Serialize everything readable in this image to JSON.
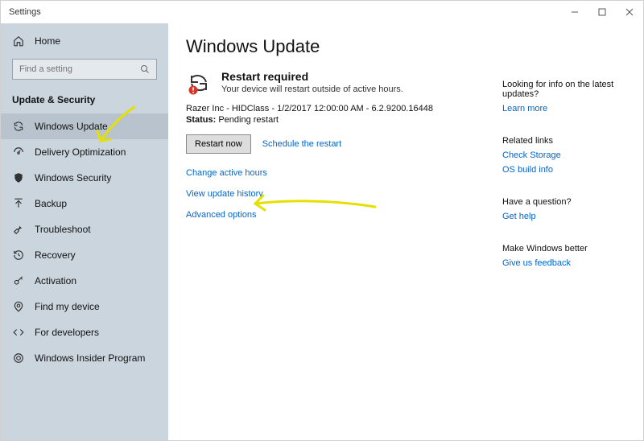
{
  "window": {
    "title": "Settings"
  },
  "sidebar": {
    "home": "Home",
    "search_placeholder": "Find a setting",
    "category": "Update & Security",
    "items": [
      {
        "label": "Windows Update"
      },
      {
        "label": "Delivery Optimization"
      },
      {
        "label": "Windows Security"
      },
      {
        "label": "Backup"
      },
      {
        "label": "Troubleshoot"
      },
      {
        "label": "Recovery"
      },
      {
        "label": "Activation"
      },
      {
        "label": "Find my device"
      },
      {
        "label": "For developers"
      },
      {
        "label": "Windows Insider Program"
      }
    ]
  },
  "main": {
    "heading": "Windows Update",
    "status_title": "Restart required",
    "status_sub": "Your device will restart outside of active hours.",
    "update_line": "Razer Inc - HIDClass - 1/2/2017 12:00:00 AM - 6.2.9200.16448",
    "status_label": "Status:",
    "status_value": "Pending restart",
    "restart_btn": "Restart now",
    "schedule_link": "Schedule the restart",
    "links": {
      "change_hours": "Change active hours",
      "view_history": "View update history",
      "advanced": "Advanced options"
    }
  },
  "right": {
    "info_title": "Looking for info on the latest updates?",
    "info_link": "Learn more",
    "related_title": "Related links",
    "related_links": {
      "storage": "Check Storage",
      "build": "OS build info"
    },
    "question_title": "Have a question?",
    "question_link": "Get help",
    "better_title": "Make Windows better",
    "better_link": "Give us feedback"
  }
}
